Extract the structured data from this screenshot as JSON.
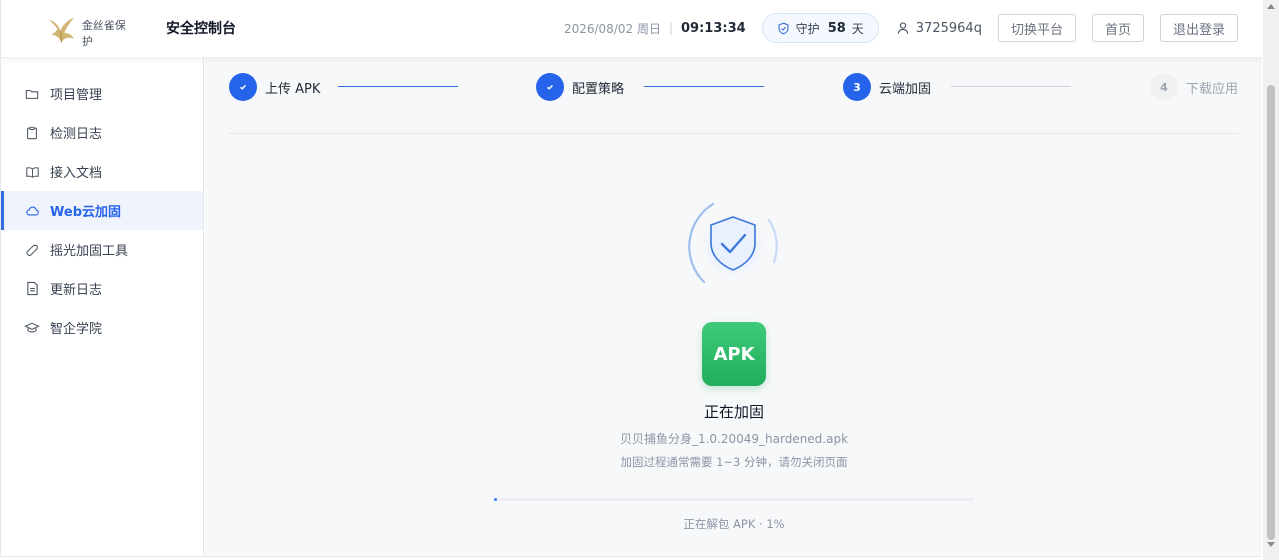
{
  "header": {
    "logo_text": "金丝雀保护",
    "console_title": "安全控制台",
    "date": "2026/08/02 周日",
    "separator": "|",
    "time": "09:13:34",
    "guard": {
      "prefix": "守护",
      "days": "58",
      "suffix": "天"
    },
    "user_id": "3725964q",
    "buttons": {
      "switch": "切换平台",
      "home": "首页",
      "logout": "退出登录"
    }
  },
  "sidebar": {
    "items": [
      {
        "label": "项目管理",
        "icon": "folder-icon"
      },
      {
        "label": "检测日志",
        "icon": "clipboard-icon"
      },
      {
        "label": "接入文档",
        "icon": "book-icon"
      },
      {
        "label": "Web云加固",
        "icon": "cloud-icon",
        "active": true
      },
      {
        "label": "摇光加固工具",
        "icon": "tag-icon"
      },
      {
        "label": "更新日志",
        "icon": "document-icon"
      },
      {
        "label": "智企学院",
        "icon": "graduation-cap-icon"
      }
    ]
  },
  "steps": [
    {
      "label": "上传 APK",
      "state": "done",
      "index": ""
    },
    {
      "label": "配置策略",
      "state": "done",
      "index": ""
    },
    {
      "label": "云端加固",
      "state": "current",
      "index": "3"
    },
    {
      "label": "下载应用",
      "state": "todo",
      "index": "4"
    }
  ],
  "main": {
    "apk_badge": "APK",
    "status_title": "正在加固",
    "filename": "贝贝捕鱼分身_1.0.20049_hardened.apk",
    "hint": "加固过程通常需要 1~3 分钟，请勿关闭页面",
    "progress_percent": 1,
    "progress_text": "正在解包 APK · 1%"
  },
  "colors": {
    "accent": "#2563eb",
    "apk_green": "#2fbf6c",
    "muted_text": "#8b95a5",
    "active_bg": "#eef3fc"
  }
}
